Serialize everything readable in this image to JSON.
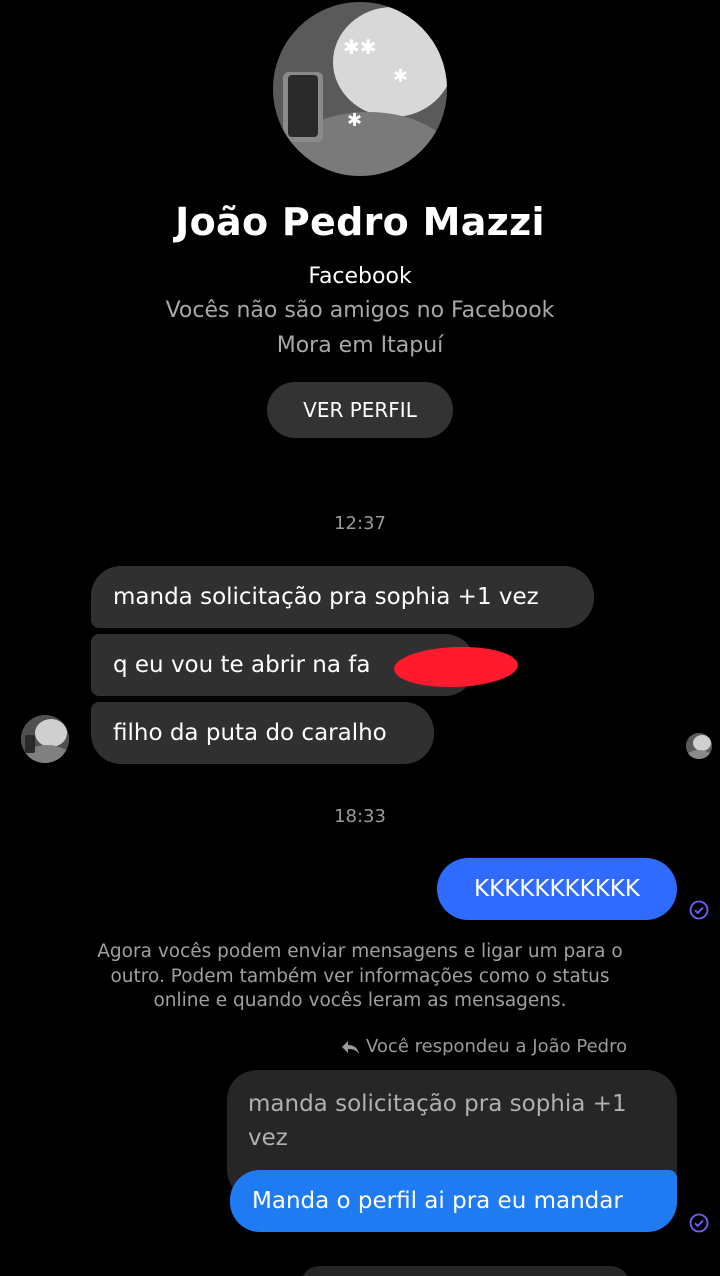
{
  "profile": {
    "name": "João Pedro Mazzi",
    "platform": "Facebook",
    "friend_status": "Vocês não são amigos no Facebook",
    "location": "Mora em Itapuí",
    "view_profile_label": "VER PERFIL"
  },
  "thread": {
    "timestamp_1": "12:37",
    "incoming": [
      "manda solicitação pra sophia  +1 vez",
      "q eu vou te abrir na fa",
      "filho da puta do caralho"
    ],
    "timestamp_2": "18:33",
    "outgoing_1": "KKKKKKKKKKK",
    "system_note": "Agora vocês podem enviar mensagens e ligar um para o outro. Podem também ver informações como o status online e quando vocês leram as mensagens.",
    "reply_label": "Você respondeu a João Pedro",
    "reply_quote": "manda solicitação pra sophia  +1 vez",
    "outgoing_2": "Manda o perfil ai pra eu mandar"
  },
  "colors": {
    "background": "#000000",
    "incoming_bubble": "#303030",
    "outgoing_bubble": "#2f6bff",
    "redaction": "#ff1a2e",
    "sent_check": "#7a5cff"
  },
  "icons": {
    "reply": "reply-arrow-icon",
    "sent": "check-circle-icon"
  }
}
